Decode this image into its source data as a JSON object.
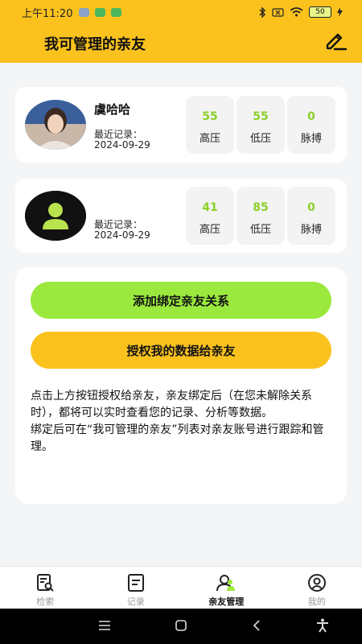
{
  "status_bar": {
    "time": "上午11:20",
    "battery": "50"
  },
  "header": {
    "title": "我可管理的亲友"
  },
  "friends": [
    {
      "name": "虞哈哈",
      "recent_label": "最近记录：",
      "recent_date": "2024-09-29",
      "stats": [
        {
          "value": "55",
          "label": "高压"
        },
        {
          "value": "55",
          "label": "低压"
        },
        {
          "value": "0",
          "label": "脉搏"
        }
      ]
    },
    {
      "name": "",
      "recent_label": "最近记录：",
      "recent_date": "2024-09-29",
      "stats": [
        {
          "value": "41",
          "label": "高压"
        },
        {
          "value": "85",
          "label": "低压"
        },
        {
          "value": "0",
          "label": "脉搏"
        }
      ]
    }
  ],
  "actions": {
    "add_label": "添加绑定亲友关系",
    "authorize_label": "授权我的数据给亲友"
  },
  "description": {
    "line1": "点击上方按钮授权给亲友，亲友绑定后（在您未解除关系时），都将可以实时查看您的记录、分析等数据。",
    "line2": "绑定后可在“我可管理的亲友”列表对亲友账号进行跟踪和管理。"
  },
  "tabs": [
    {
      "label": "检索",
      "icon": "search-doc-icon"
    },
    {
      "label": "记录",
      "icon": "record-icon"
    },
    {
      "label": "亲友管理",
      "icon": "family-icon",
      "active": true
    },
    {
      "label": "我的",
      "icon": "profile-icon"
    }
  ],
  "colors": {
    "header": "#fbc21e",
    "accent_green": "#9be93e",
    "stat_value": "#8bd02a"
  }
}
